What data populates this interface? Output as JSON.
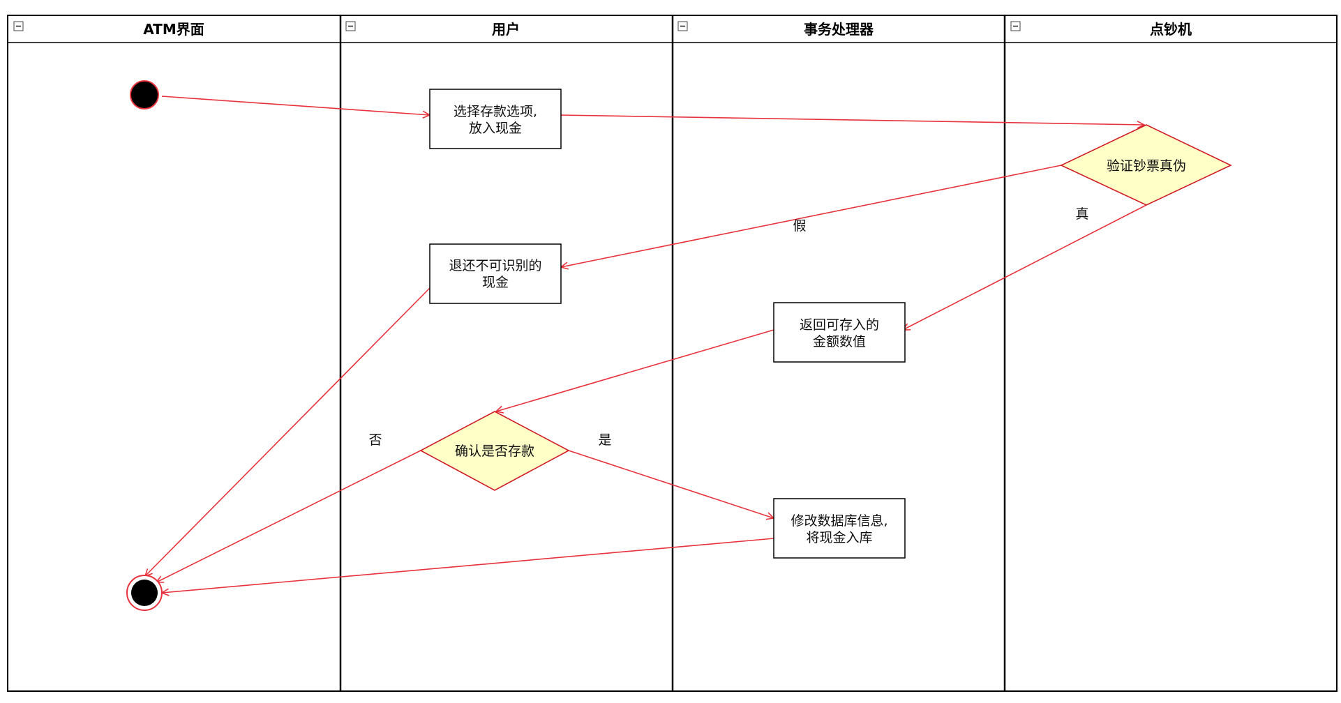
{
  "lanes": [
    {
      "title": "ATM界面"
    },
    {
      "title": "用户"
    },
    {
      "title": "事务处理器"
    },
    {
      "title": "点钞机"
    }
  ],
  "nodes": {
    "select_deposit": {
      "lines": [
        "选择存款选项,",
        "放入现金"
      ]
    },
    "verify_notes": {
      "lines": [
        "验证钞票真伪"
      ]
    },
    "return_cash": {
      "lines": [
        "退还不可识别的",
        "现金"
      ]
    },
    "return_amount": {
      "lines": [
        "返回可存入的",
        "金额数值"
      ]
    },
    "confirm_deposit": {
      "lines": [
        "确认是否存款"
      ]
    },
    "update_db": {
      "lines": [
        "修改数据库信息,",
        "将现金入库"
      ]
    }
  },
  "edge_labels": {
    "false": "假",
    "true": "真",
    "no": "否",
    "yes": "是"
  },
  "colors": {
    "edge": "#e8323c",
    "decision_fill": "#ffffc8",
    "decision_stroke": "#d01c24",
    "lane_border": "#000000",
    "node_stroke": "#000000",
    "node_fill": "#ffffff"
  }
}
